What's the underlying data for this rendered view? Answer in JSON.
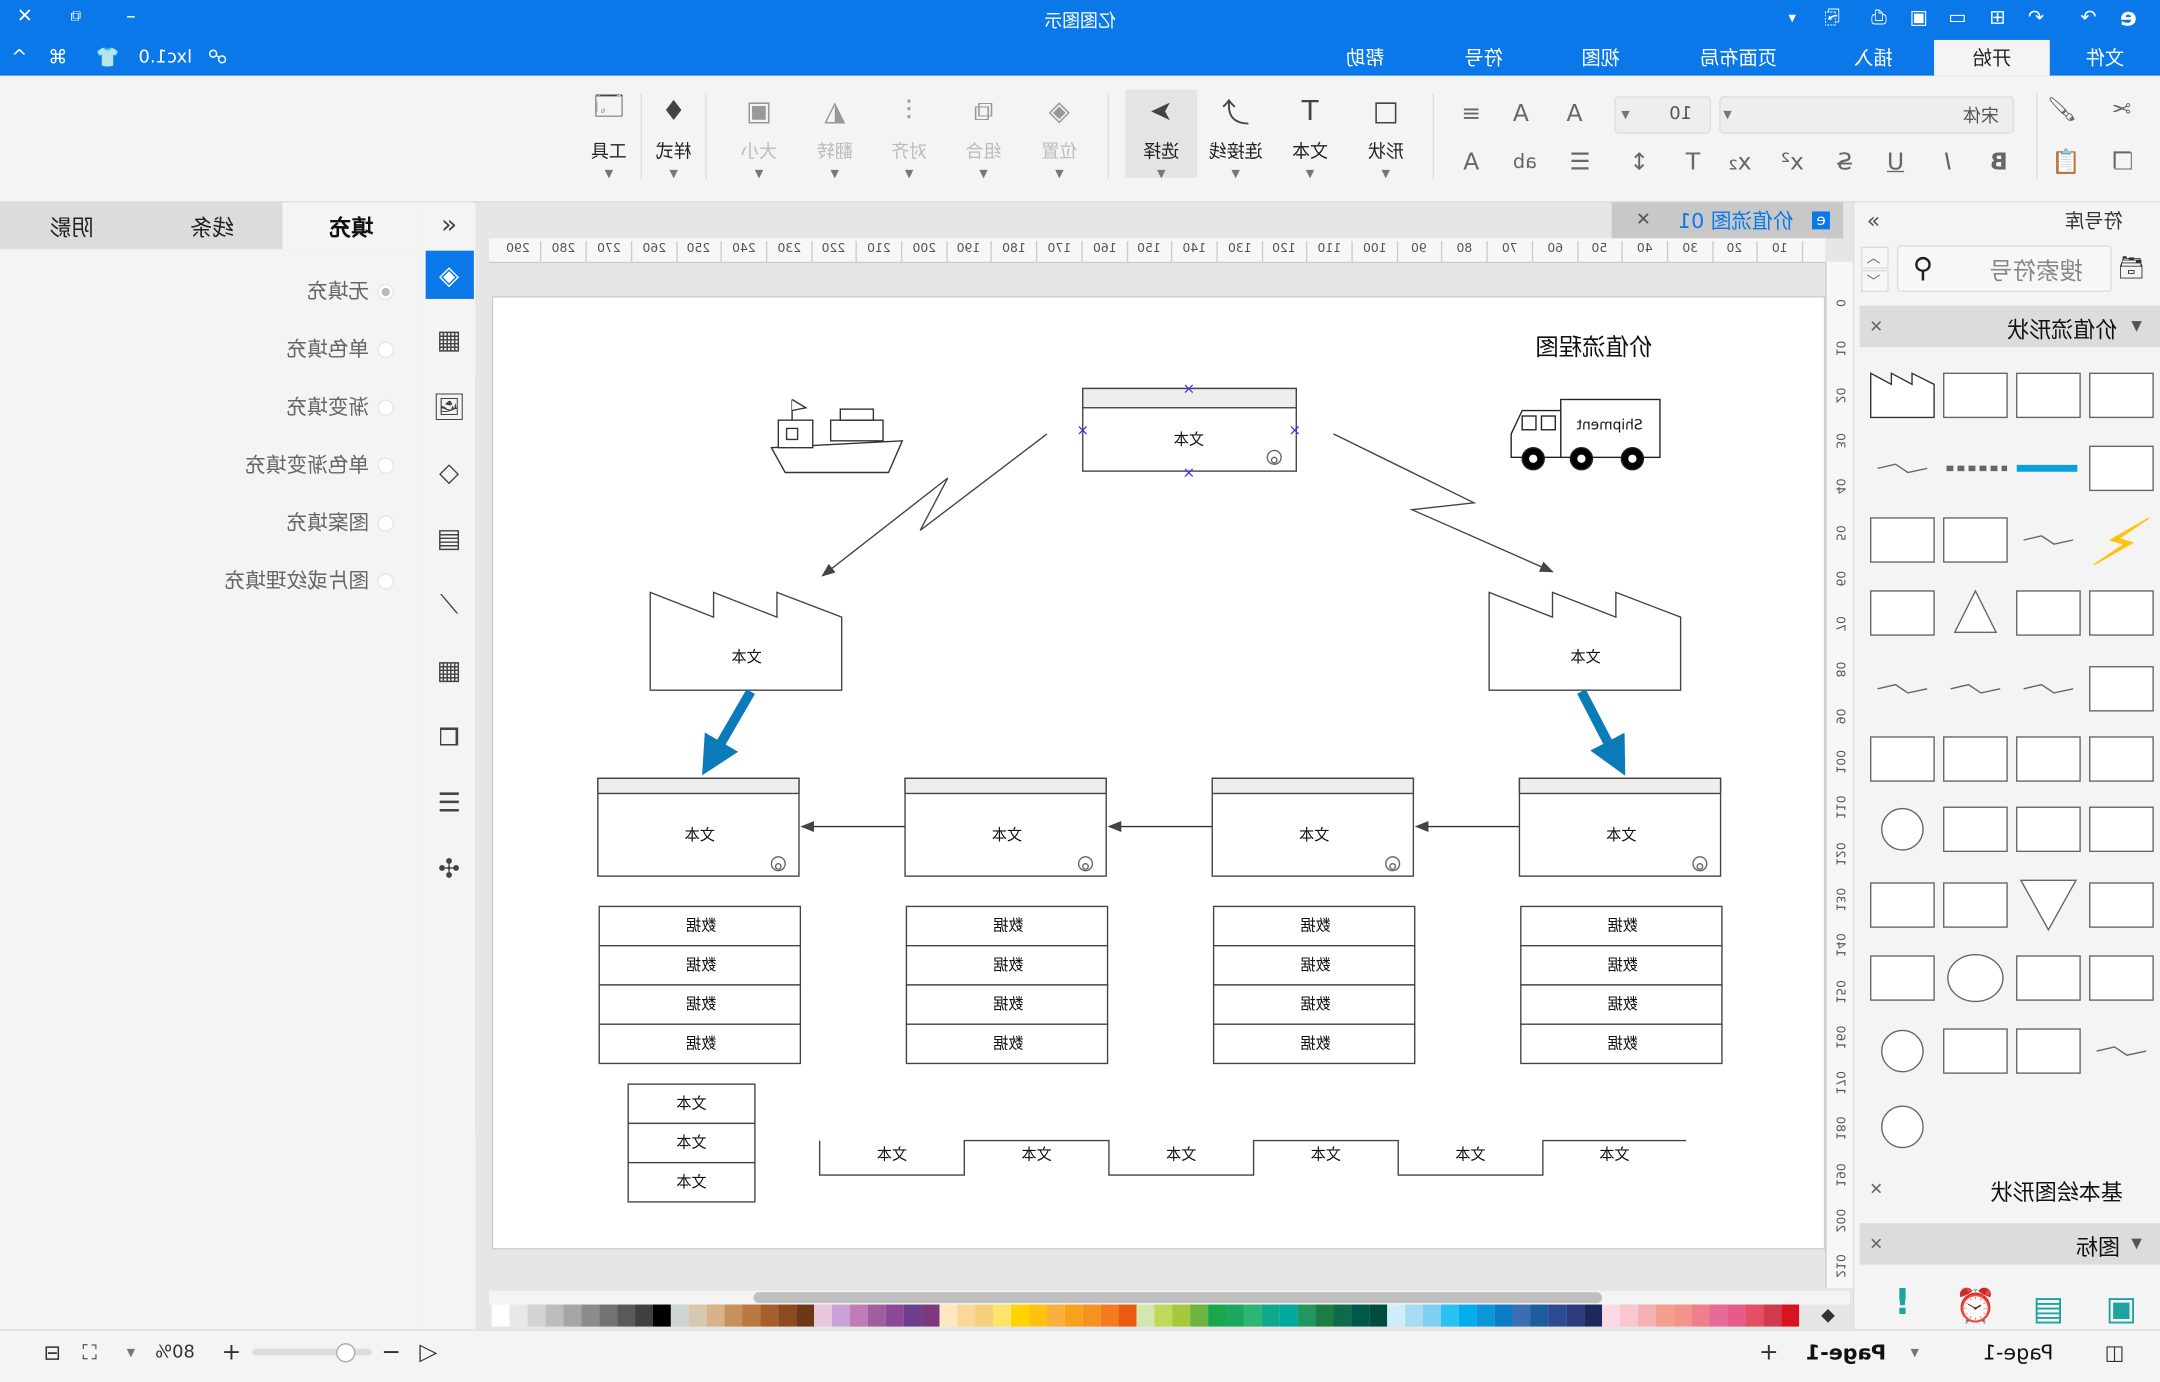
{
  "window": {
    "title": "亿图图示",
    "file_name": "lxc1.0",
    "accent": "#0a78e8"
  },
  "menu_tabs": [
    {
      "label": "文件"
    },
    {
      "label": "开始",
      "active": true
    },
    {
      "label": "插入"
    },
    {
      "label": "页面布局"
    },
    {
      "label": "视图"
    },
    {
      "label": "符号"
    },
    {
      "label": "帮助"
    }
  ],
  "ribbon": {
    "tools": [
      {
        "label": "工具",
        "icon": "tools-icon"
      },
      {
        "label": "样式",
        "icon": "style-icon"
      },
      {
        "label": "大小",
        "icon": "size-icon",
        "disabled": true
      },
      {
        "label": "翻转",
        "icon": "flip-icon",
        "disabled": true
      },
      {
        "label": "对齐",
        "icon": "align-icon",
        "disabled": true
      },
      {
        "label": "组合",
        "icon": "group-icon",
        "disabled": true
      },
      {
        "label": "位置",
        "icon": "position-icon",
        "disabled": true
      },
      {
        "label": "选择",
        "icon": "select-icon",
        "active": true
      },
      {
        "label": "连接线",
        "icon": "connector-icon"
      },
      {
        "label": "文本",
        "icon": "text-icon"
      },
      {
        "label": "形状",
        "icon": "shape-icon"
      }
    ],
    "font_size": "10",
    "font_name": "宋体"
  },
  "format_panel": {
    "tabs": [
      {
        "label": "填充",
        "active": true
      },
      {
        "label": "线条"
      },
      {
        "label": "阴影"
      }
    ],
    "options": [
      {
        "label": "无填充",
        "selected": true
      },
      {
        "label": "单色填充"
      },
      {
        "label": "渐变填充"
      },
      {
        "label": "单色渐变填充"
      },
      {
        "label": "图案填充"
      },
      {
        "label": "图片或纹理填充"
      }
    ]
  },
  "document_tab": {
    "label": "价值流图 01"
  },
  "rulers": {
    "horizontal": [
      "10",
      "20",
      "30",
      "40",
      "50",
      "60",
      "70",
      "80",
      "90",
      "100",
      "110",
      "120",
      "130",
      "140",
      "150",
      "160",
      "170",
      "180",
      "190",
      "200",
      "210",
      "220",
      "230",
      "240",
      "250",
      "260",
      "270",
      "280",
      "290"
    ],
    "vertical": [
      "0",
      "10",
      "20",
      "30",
      "40",
      "50",
      "60",
      "70",
      "80",
      "90",
      "100",
      "110",
      "120",
      "130",
      "140",
      "150",
      "160",
      "170",
      "180",
      "190",
      "200",
      "210"
    ]
  },
  "diagram": {
    "title": "价值流程图",
    "supplier_label": "文本",
    "shipment_label": "Shipment",
    "factory_labels": [
      "文本",
      "文本"
    ],
    "process_labels": [
      "文本",
      "文本",
      "文本",
      "文本"
    ],
    "data_label": "数据",
    "small_table": [
      "文本",
      "文本",
      "文本"
    ],
    "timeline": [
      "文本",
      "文本",
      "文本",
      "文本",
      "文本",
      "文本"
    ],
    "arrow_color": "#0a7ab8"
  },
  "symbol_library": {
    "title": "符号库",
    "search_placeholder": "搜索符号",
    "sections": [
      {
        "label": "价值流形状",
        "expanded": true
      },
      {
        "label": "基本绘图形状"
      },
      {
        "label": "图标"
      }
    ]
  },
  "palette": [
    "#ffffff",
    "#e8e8e8",
    "#d4d4d4",
    "#bdbdbd",
    "#a6a6a6",
    "#8c8c8c",
    "#737373",
    "#595959",
    "#404040",
    "#000000",
    "#cfd6cf",
    "#d9c8b0",
    "#d8b38a",
    "#c7915c",
    "#b87840",
    "#a65f2a",
    "#8d4a1f",
    "#6e3718",
    "#e8c8de",
    "#c9a0d8",
    "#c07ab6",
    "#a05e9e",
    "#8a4a95",
    "#6e3e8e",
    "#7b3a7e",
    "#ffe8c0",
    "#fbd79a",
    "#f6cf7d",
    "#ffe36a",
    "#ffd400",
    "#ffc20e",
    "#fbb03b",
    "#f7a21b",
    "#f6921e",
    "#f47c20",
    "#ea5a0f",
    "#d3e8b0",
    "#c0d95a",
    "#a6c83a",
    "#6cb43f",
    "#18a84b",
    "#1aa85f",
    "#2bb673",
    "#10a88c",
    "#00a99d",
    "#22965f",
    "#1b7d44",
    "#0d6b49",
    "#00584b",
    "#004c3f",
    "#cfeefb",
    "#a8dcf5",
    "#7fcff3",
    "#29c1f1",
    "#00aeef",
    "#0a96d8",
    "#0a7cc4",
    "#3b6db3",
    "#1c5d9e",
    "#2d4a94",
    "#2e3a7e",
    "#1b2a5c",
    "#fbd9e4",
    "#f8c7cf",
    "#f5b2b2",
    "#f3a08e",
    "#f4958b",
    "#ef7f8a",
    "#e56b98",
    "#e75b8a",
    "#e54f62",
    "#cf3a4c",
    "#d7141f"
  ],
  "status_bar": {
    "zoom": "80%",
    "page_tab": "Page-1",
    "page_select": "Page-1"
  }
}
